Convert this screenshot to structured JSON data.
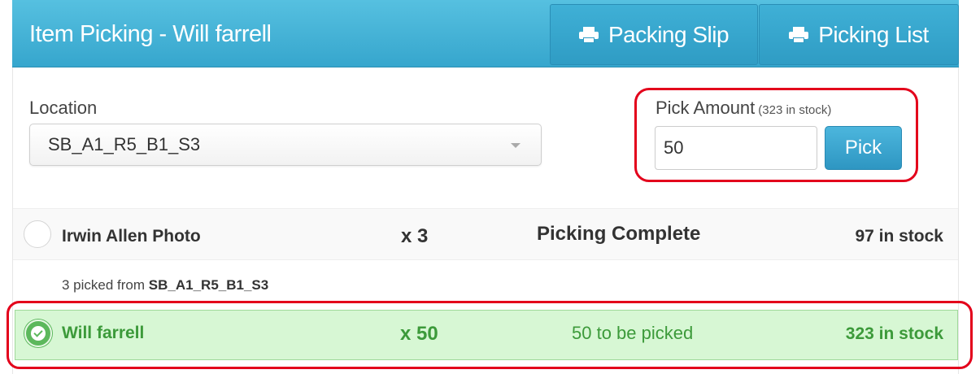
{
  "header": {
    "title": "Item Picking - Will farrell",
    "packing_slip_label": "Packing Slip",
    "picking_list_label": "Picking List"
  },
  "location": {
    "label": "Location",
    "selected": "SB_A1_R5_B1_S3"
  },
  "pick": {
    "label": "Pick Amount",
    "stock_note": "(323 in stock)",
    "amount": "50",
    "button_label": "Pick"
  },
  "items": [
    {
      "name": "Irwin Allen Photo",
      "qty": "x 3",
      "status": "Picking Complete",
      "stock": "97 in stock",
      "picked_text": "3 picked from",
      "picked_location": "SB_A1_R5_B1_S3"
    },
    {
      "name": "Will farrell",
      "qty": "x 50",
      "status": "50 to be picked",
      "stock": "323 in stock"
    }
  ],
  "colors": {
    "header": "#3aabd2",
    "highlight_outline": "#e3001b",
    "selected_row": "#d7f7d4",
    "success_text": "#3c9a3a"
  },
  "icons": [
    "print-icon",
    "circle-icon",
    "check-circle-icon",
    "chevron-down-icon"
  ]
}
